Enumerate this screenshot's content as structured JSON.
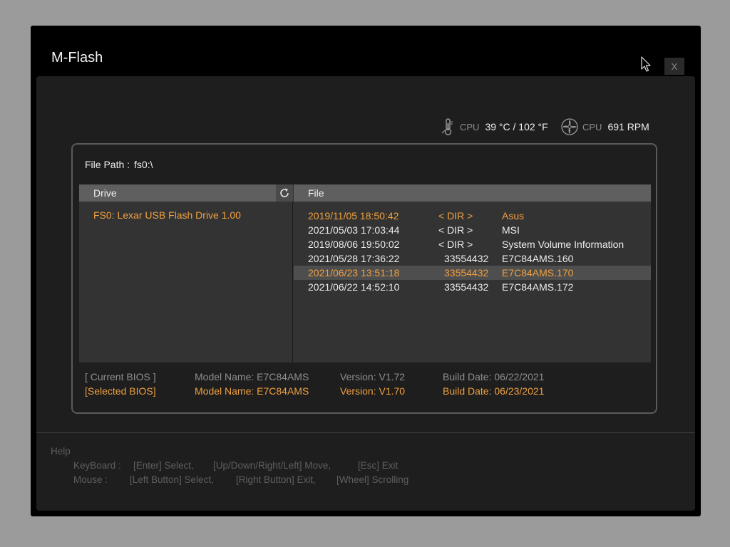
{
  "window": {
    "title": "M-Flash",
    "close_label": "X"
  },
  "sensors": {
    "cpu_temp": {
      "label": "CPU",
      "value": "39 °C / 102 °F"
    },
    "cpu_fan": {
      "label": "CPU",
      "value": "691 RPM"
    }
  },
  "file_path": {
    "label": "File Path :",
    "value": "fs0:\\"
  },
  "columns": {
    "drive": "Drive",
    "file": "File"
  },
  "drives": [
    {
      "label": "FS0: Lexar USB Flash Drive 1.00"
    }
  ],
  "files": [
    {
      "date": "2019/11/05 18:50:42",
      "type": "< DIR >",
      "size": "",
      "name": "Asus",
      "state": "selected"
    },
    {
      "date": "2021/05/03 17:03:44",
      "type": "< DIR >",
      "size": "",
      "name": "MSI",
      "state": "normal"
    },
    {
      "date": "2019/08/06 19:50:02",
      "type": "< DIR >",
      "size": "",
      "name": "System Volume Information",
      "state": "normal"
    },
    {
      "date": "2021/05/28 17:36:22",
      "type": "",
      "size": "33554432",
      "name": "E7C84AMS.160",
      "state": "normal"
    },
    {
      "date": "2021/06/23 13:51:18",
      "type": "",
      "size": "33554432",
      "name": "E7C84AMS.170",
      "state": "highlighted"
    },
    {
      "date": "2021/06/22 14:52:10",
      "type": "",
      "size": "33554432",
      "name": "E7C84AMS.172",
      "state": "normal"
    }
  ],
  "bios": {
    "current": {
      "label": "[ Current BIOS  ]",
      "model": "Model Name: E7C84AMS",
      "version": "Version: V1.72",
      "build": "Build Date: 06/22/2021"
    },
    "selected": {
      "label": "[Selected BIOS]",
      "model": "Model Name: E7C84AMS",
      "version": "Version: V1.70",
      "build": "Build Date: 06/23/2021"
    }
  },
  "help": {
    "title": "Help",
    "keyboard": {
      "label": "KeyBoard :",
      "items": [
        "[Enter]  Select,",
        "[Up/Down/Right/Left]  Move,",
        "[Esc]  Exit"
      ]
    },
    "mouse": {
      "label": "Mouse    :",
      "items": [
        "[Left Button]  Select,",
        "[Right Button]  Exit,",
        "[Wheel]  Scrolling"
      ]
    }
  },
  "colors": {
    "accent": "#f0a040",
    "text": "#ececec",
    "muted": "#8e8e8e",
    "panel": "#1e1e1e"
  }
}
